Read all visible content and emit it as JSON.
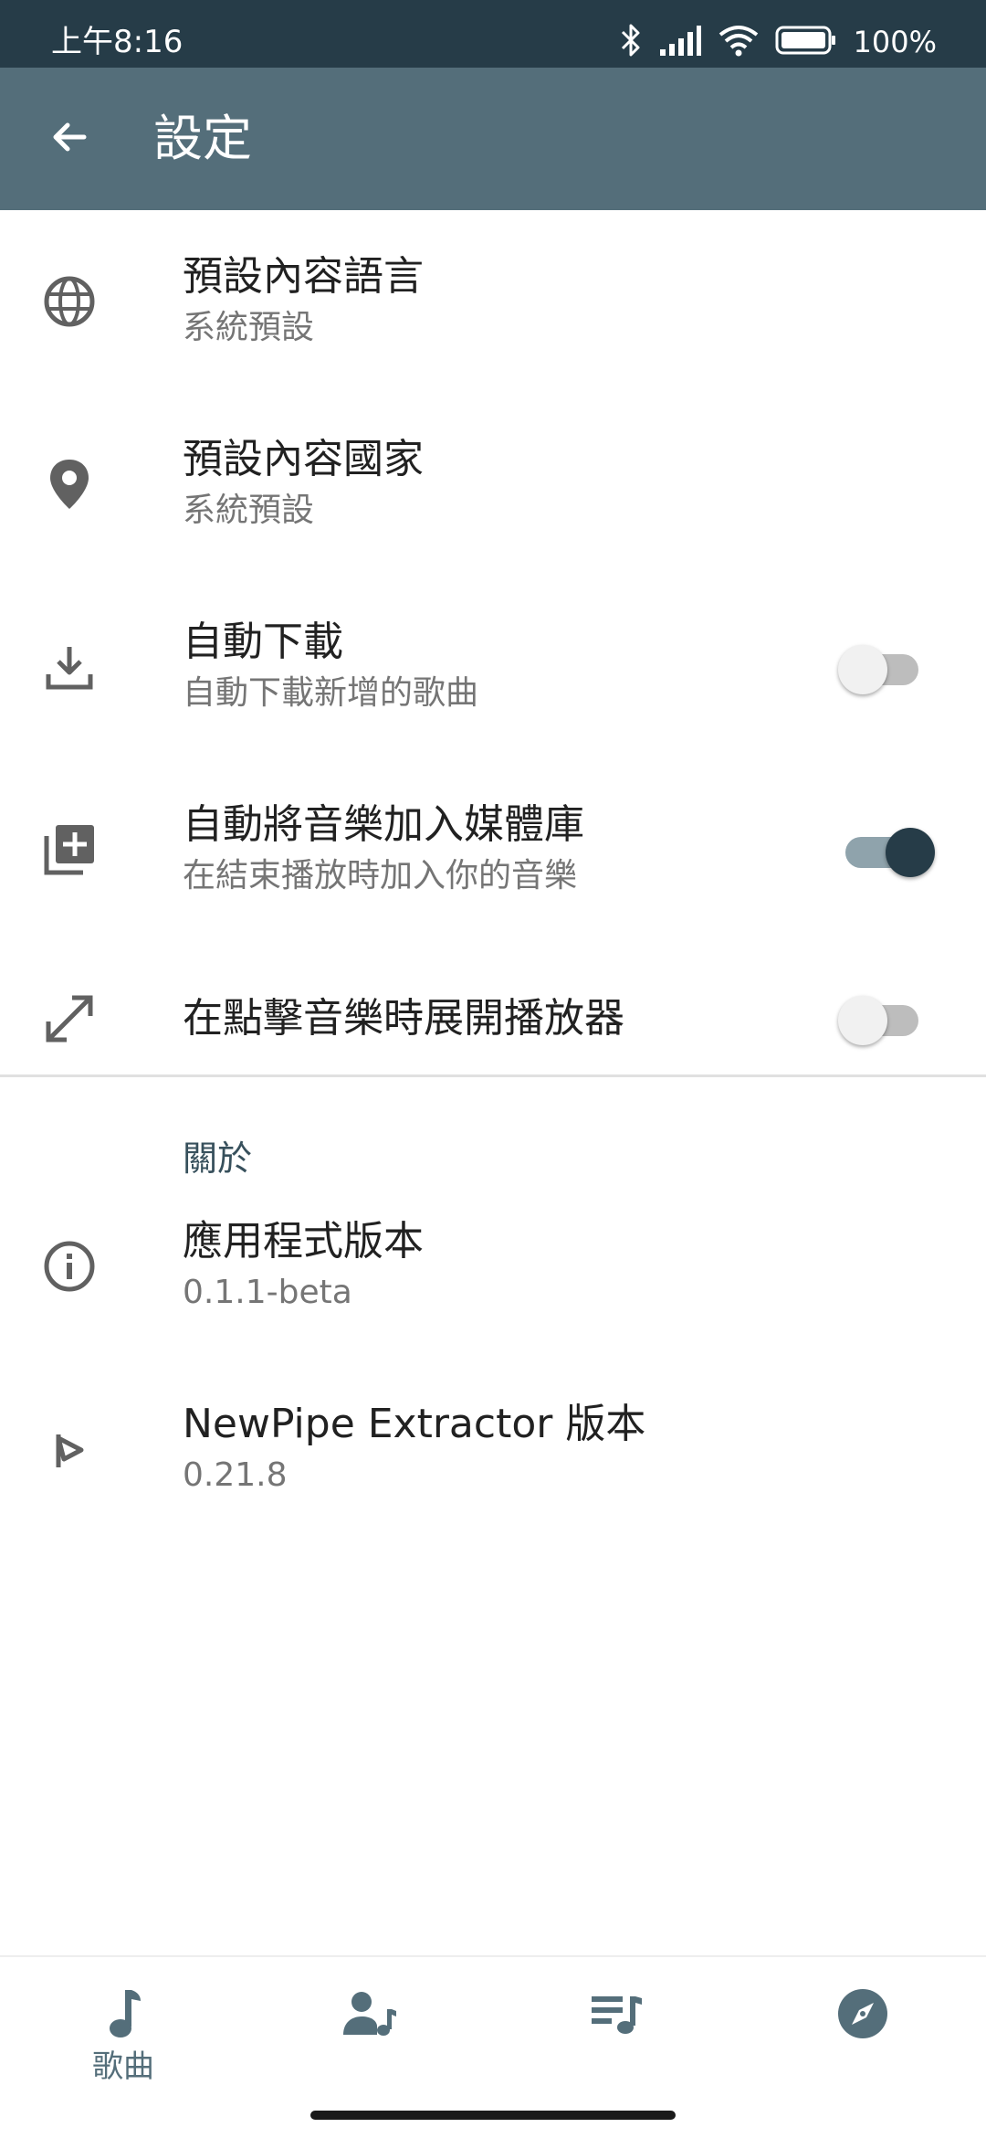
{
  "status": {
    "time": "上午8:16",
    "battery": "100%",
    "icons": [
      "bluetooth-icon",
      "signal-icon",
      "wifi-icon",
      "battery-icon"
    ]
  },
  "appbar": {
    "title": "設定",
    "back_icon": "arrow-back-icon",
    "background": "#546e7a"
  },
  "settings": [
    {
      "icon": "globe-icon",
      "title": "預設內容語言",
      "subtitle": "系統預設"
    },
    {
      "icon": "location-pin-icon",
      "title": "預設內容國家",
      "subtitle": "系統預設"
    },
    {
      "icon": "download-icon",
      "title": "自動下載",
      "subtitle": "自動下載新增的歌曲",
      "toggle": false
    },
    {
      "icon": "library-add-icon",
      "title": "自動將音樂加入媒體庫",
      "subtitle": "在結束播放時加入你的音樂",
      "toggle": true
    },
    {
      "icon": "expand-icon",
      "title": "在點擊音樂時展開播放器",
      "toggle": false
    }
  ],
  "about": {
    "header": "關於",
    "items": [
      {
        "icon": "info-icon",
        "title": "應用程式版本",
        "subtitle": "0.1.1-beta"
      },
      {
        "icon": "newpipe-icon",
        "title": "NewPipe Extractor 版本",
        "subtitle": "0.21.8"
      }
    ]
  },
  "bottom_nav": [
    {
      "icon": "music-note-icon",
      "label": "歌曲",
      "selected": true
    },
    {
      "icon": "artist-icon",
      "selected": false
    },
    {
      "icon": "playlist-icon",
      "selected": false
    },
    {
      "icon": "explore-icon",
      "selected": false
    }
  ],
  "colors": {
    "statusbar": "#263c48",
    "accent": "#263c48",
    "icon": "#616161",
    "section_header": "#37505c"
  }
}
